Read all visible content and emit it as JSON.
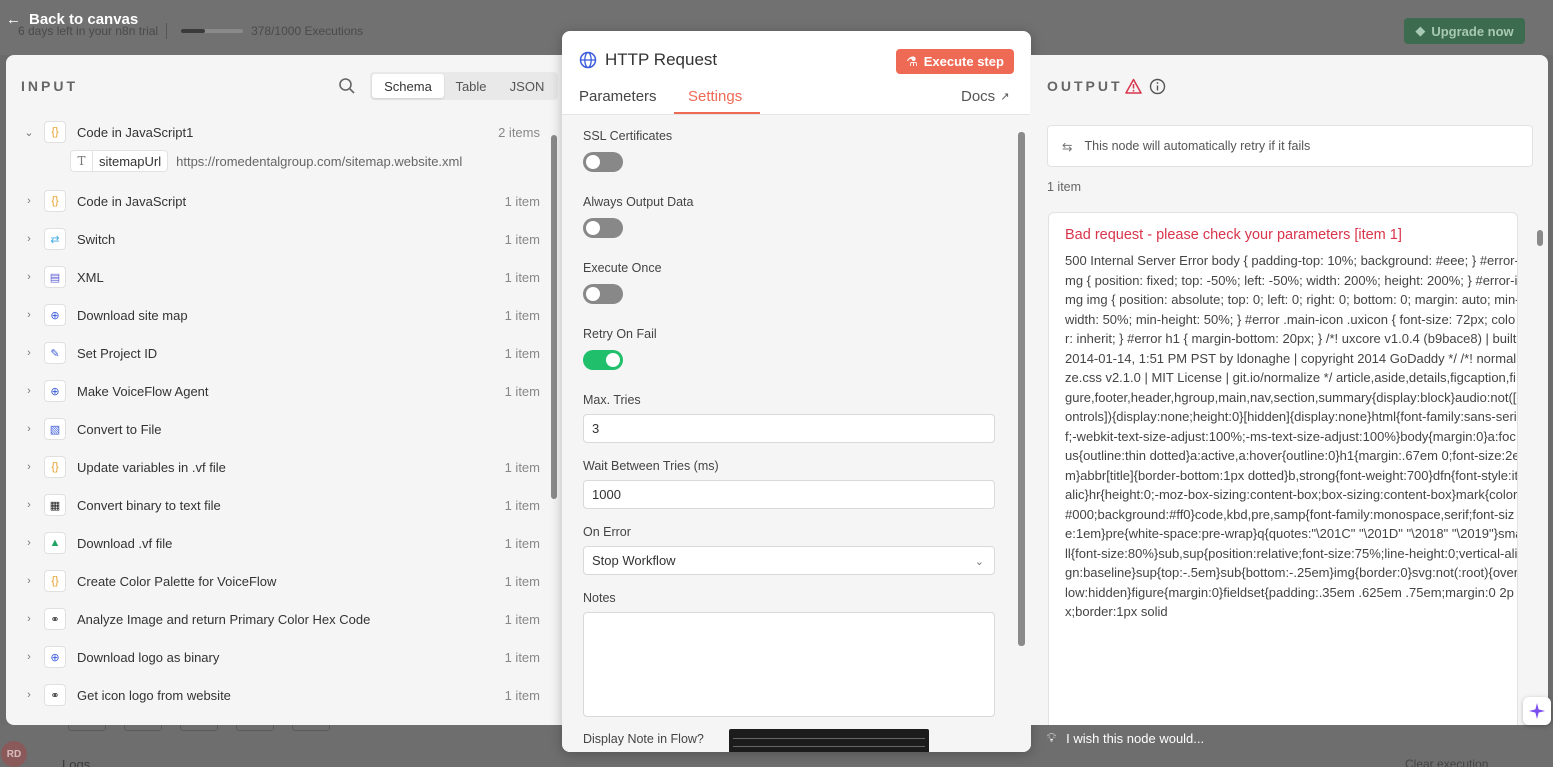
{
  "trial": {
    "days_left": "6 days left in your n8n trial",
    "executions": "378/1000 Executions",
    "upgrade_label": "Upgrade now"
  },
  "back_label": "Back to canvas",
  "input": {
    "title": "INPUT",
    "views": [
      "Schema",
      "Table",
      "JSON"
    ],
    "active_view": "Schema",
    "nodes": [
      {
        "name": "Code in JavaScript1",
        "count": "2 items",
        "icon": "code-braces-icon",
        "expanded": true
      },
      {
        "name": "Code in JavaScript",
        "count": "1 item",
        "icon": "code-braces-icon"
      },
      {
        "name": "Switch",
        "count": "1 item",
        "icon": "switch-icon"
      },
      {
        "name": "XML",
        "count": "1 item",
        "icon": "file-xml-icon"
      },
      {
        "name": "Download site map",
        "count": "1 item",
        "icon": "globe-icon"
      },
      {
        "name": "Set Project ID",
        "count": "1 item",
        "icon": "pencil-icon"
      },
      {
        "name": "Make VoiceFlow Agent",
        "count": "1 item",
        "icon": "globe-icon"
      },
      {
        "name": "Convert to File",
        "count": "",
        "icon": "file-convert-icon"
      },
      {
        "name": "Update variables in .vf file",
        "count": "1 item",
        "icon": "code-braces-icon"
      },
      {
        "name": "Convert binary to text file",
        "count": "1 item",
        "icon": "file-binary-icon"
      },
      {
        "name": "Download .vf file",
        "count": "1 item",
        "icon": "google-drive-icon"
      },
      {
        "name": "Create Color Palette for VoiceFlow",
        "count": "1 item",
        "icon": "code-braces-icon"
      },
      {
        "name": "Analyze Image and return Primary Color Hex Code",
        "count": "1 item",
        "icon": "link-icon"
      },
      {
        "name": "Download logo as binary",
        "count": "1 item",
        "icon": "globe-icon"
      },
      {
        "name": "Get icon logo from website",
        "count": "1 item",
        "icon": "link-icon"
      }
    ],
    "sub_field": {
      "key": "sitemapUrl",
      "value": "https://romedentalgroup.com/sitemap.website.xml"
    }
  },
  "node": {
    "title": "HTTP Request",
    "execute_label": "Execute step",
    "tabs": [
      "Parameters",
      "Settings"
    ],
    "active_tab": "Settings",
    "docs_label": "Docs",
    "settings": {
      "ssl_label": "SSL Certificates",
      "ssl_on": false,
      "always_output_label": "Always Output Data",
      "always_output_on": false,
      "execute_once_label": "Execute Once",
      "execute_once_on": false,
      "retry_label": "Retry On Fail",
      "retry_on": true,
      "max_tries_label": "Max. Tries",
      "max_tries_value": "3",
      "wait_label": "Wait Between Tries (ms)",
      "wait_value": "1000",
      "on_error_label": "On Error",
      "on_error_value": "Stop Workflow",
      "notes_label": "Notes",
      "notes_value": "",
      "display_note_label": "Display Note in Flow?"
    }
  },
  "output": {
    "title": "OUTPUT",
    "retry_notice": "This node will automatically retry if it fails",
    "item_count": "1 item",
    "error_title": "Bad request - please check your parameters [item 1]",
    "error_body": "500 Internal Server Error body { padding-top: 10%; background: #eee; } #error-img { position: fixed; top: -50%; left: -50%; width: 200%; height: 200%; } #error-img img { position: absolute; top: 0; left: 0; right: 0; bottom: 0; margin: auto; min-width: 50%; min-height: 50%; } #error .main-icon .uxicon { font-size: 72px; color: inherit; } #error h1 { margin-bottom: 20px; } /*! uxcore v1.0.4 (b9bace8) | built 2014-01-14, 1:51 PM PST by ldonaghe | copyright 2014 GoDaddy */ /*! normalize.css v2.1.0 | MIT License | git.io/normalize */ article,aside,details,figcaption,figure,footer,header,hgroup,main,nav,section,summary{display:block}audio:not([controls]){display:none;height:0}[hidden]{display:none}html{font-family:sans-serif;-webkit-text-size-adjust:100%;-ms-text-size-adjust:100%}body{margin:0}a:focus{outline:thin dotted}a:active,a:hover{outline:0}h1{margin:.67em 0;font-size:2em}abbr[title]{border-bottom:1px dotted}b,strong{font-weight:700}dfn{font-style:italic}hr{height:0;-moz-box-sizing:content-box;box-sizing:content-box}mark{color:#000;background:#ff0}code,kbd,pre,samp{font-family:monospace,serif;font-size:1em}pre{white-space:pre-wrap}q{quotes:\"\\201C\" \"\\201D\" \"\\2018\" \"\\2019\"}small{font-size:80%}sub,sup{position:relative;font-size:75%;line-height:0;vertical-align:baseline}sup{top:-.5em}sub{bottom:-.25em}img{border:0}svg:not(:root){overflow:hidden}figure{margin:0}fieldset{padding:.35em .625em .75em;margin:0 2px;border:1px solid"
  },
  "wish_label": "I wish this node would...",
  "bottom": {
    "avatar_initials": "RD",
    "logs_label": "Logs",
    "clear_label": "Clear execution"
  },
  "colors": {
    "accent": "#ef6a55",
    "toggle_on": "#1fbf6b",
    "error": "#d8344b"
  }
}
